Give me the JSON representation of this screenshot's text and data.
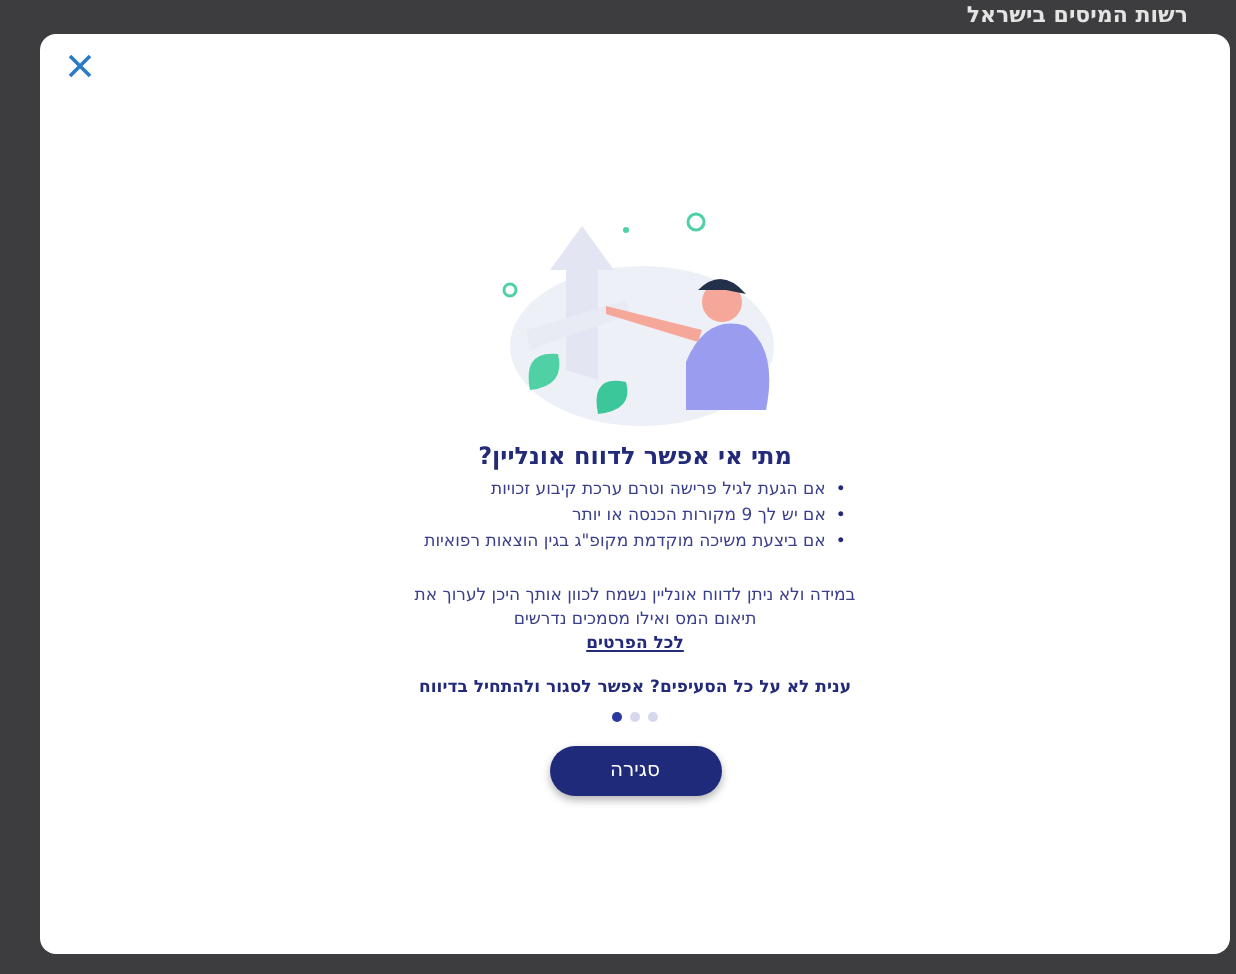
{
  "background": {
    "site_title": "רשות המיסים בישראל"
  },
  "dialog": {
    "title": "מתי אי אפשר לדווח אונליין?",
    "bullet_marker": "•",
    "bullets": [
      "אם הגעת לגיל פרישה וטרם ערכת קיבוע זכויות",
      "אם יש לך 9 מקורות הכנסה או יותר",
      "אם ביצעת משיכה מוקדמת מקופ\"ג בגין הוצאות רפואיות"
    ],
    "paragraph": "במידה ולא ניתן לדווח אונליין נשמח לכוון אותך היכן לערוך את תיאום המס ואילו מסמכים נדרשים",
    "link": "לכל הפרטים",
    "question": "ענית לא על כל הסעיפים? אפשר לסגור ולהתחיל בדיווח",
    "pages": [
      {
        "selected": true
      },
      {
        "selected": false
      },
      {
        "selected": false
      }
    ],
    "button": "סגירה"
  }
}
